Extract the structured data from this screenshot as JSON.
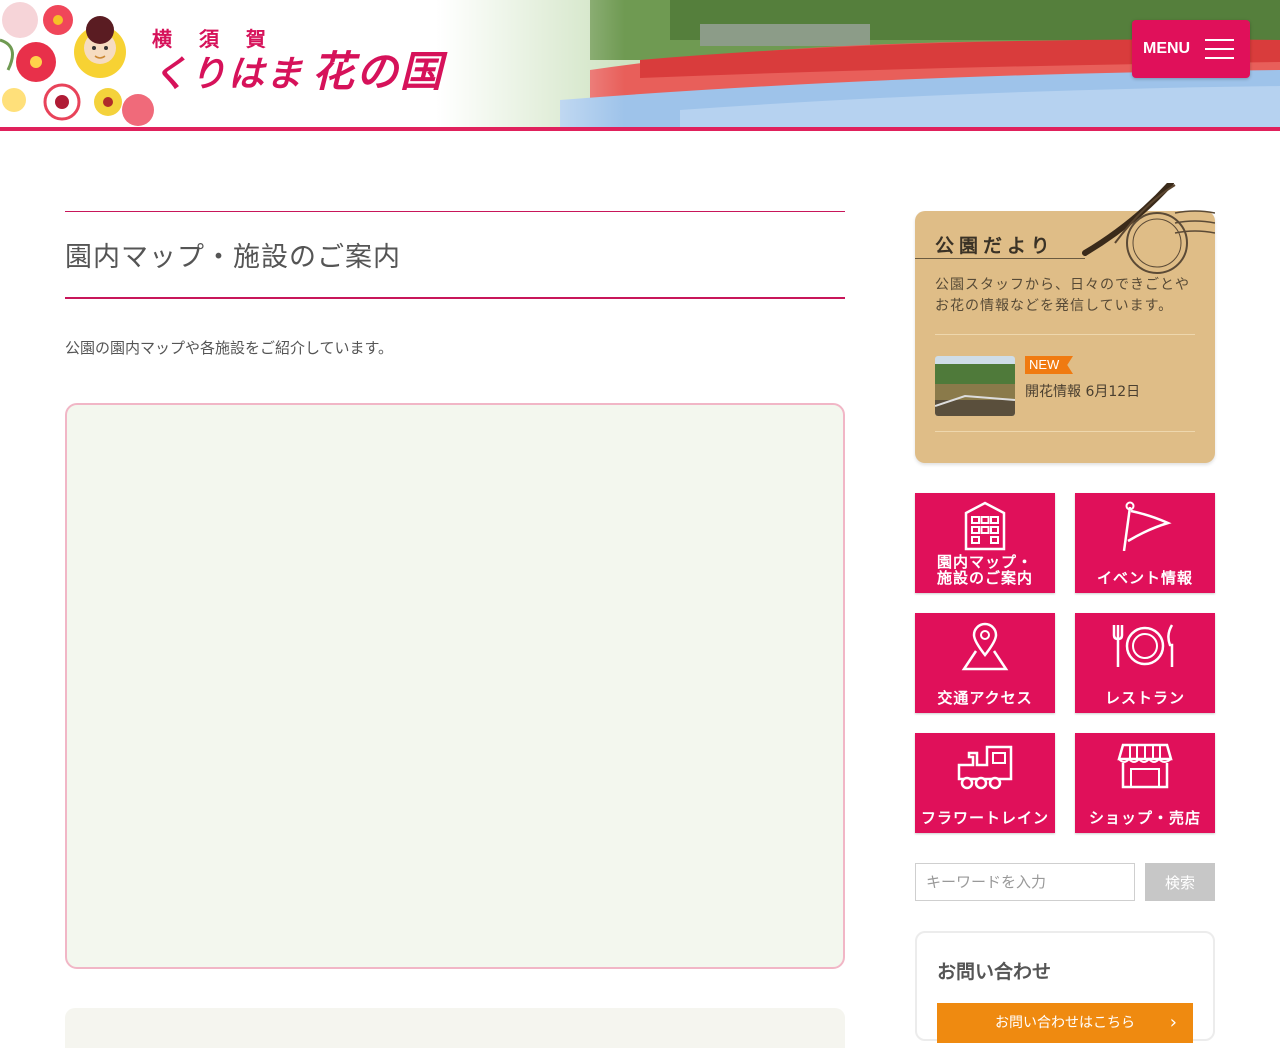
{
  "header": {
    "logo_line1": "横 須 賀",
    "logo_line2": "くりはま",
    "logo_line3": "花の国",
    "menu_label": "MENU"
  },
  "main": {
    "title": "園内マップ・施設のご案内",
    "intro": "公園の園内マップや各施設をご紹介しています。"
  },
  "blog": {
    "title": "公園だより",
    "description": "公園スタッフから、日々のできごとやお花の情報などを発信しています。",
    "badge": "NEW",
    "post_title": "開花情報 6月12日"
  },
  "tiles": [
    {
      "label_line1": "園内マップ・",
      "label_line2": "施設のご案内",
      "icon": "building-icon"
    },
    {
      "label_line1": "イベント情報",
      "label_line2": "",
      "icon": "flag-icon"
    },
    {
      "label_line1": "交通アクセス",
      "label_line2": "",
      "icon": "map-pin-icon"
    },
    {
      "label_line1": "レストラン",
      "label_line2": "",
      "icon": "restaurant-icon"
    },
    {
      "label_line1": "フラワートレイン",
      "label_line2": "",
      "icon": "train-icon"
    },
    {
      "label_line1": "ショップ・売店",
      "label_line2": "",
      "icon": "shop-icon"
    }
  ],
  "search": {
    "placeholder": "キーワードを入力",
    "button": "検索"
  },
  "contact": {
    "title": "お問い合わせ",
    "button": "お問い合わせはこちら"
  },
  "colors": {
    "accent": "#e0105a",
    "blog_bg": "#dfbd87",
    "map_bg": "#f3f7ee",
    "contact_button": "#ef8a10"
  }
}
